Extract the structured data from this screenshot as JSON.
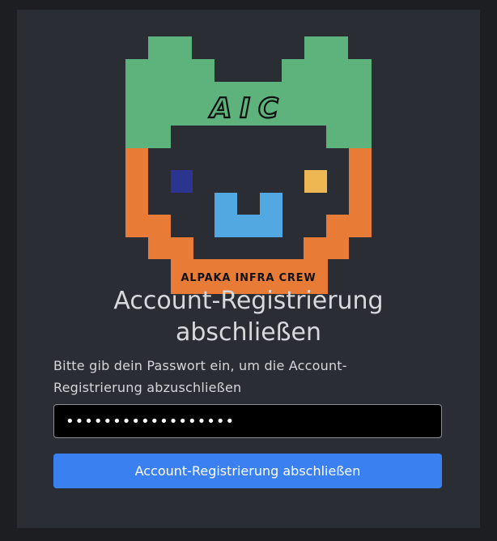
{
  "logo": {
    "title": "AIC",
    "banner": "ALPAKA INFRA CREW",
    "colors": {
      "green": "#5eb37c",
      "orange": "#e87b35",
      "face": "#2a2d33",
      "eye_left": "#2b3590",
      "eye_right": "#efb654",
      "mouth": "#52a8e0",
      "text": "#111111"
    }
  },
  "page": {
    "title_line1": "Account-Registrierung",
    "title_line2": "abschließen",
    "description_line1": "Bitte gib dein Passwort ein, um die Account-",
    "description_line2": "Registrierung abzuschließen"
  },
  "form": {
    "password_value": "password1234567890",
    "submit_label": "Account-Registrierung abschließen"
  }
}
